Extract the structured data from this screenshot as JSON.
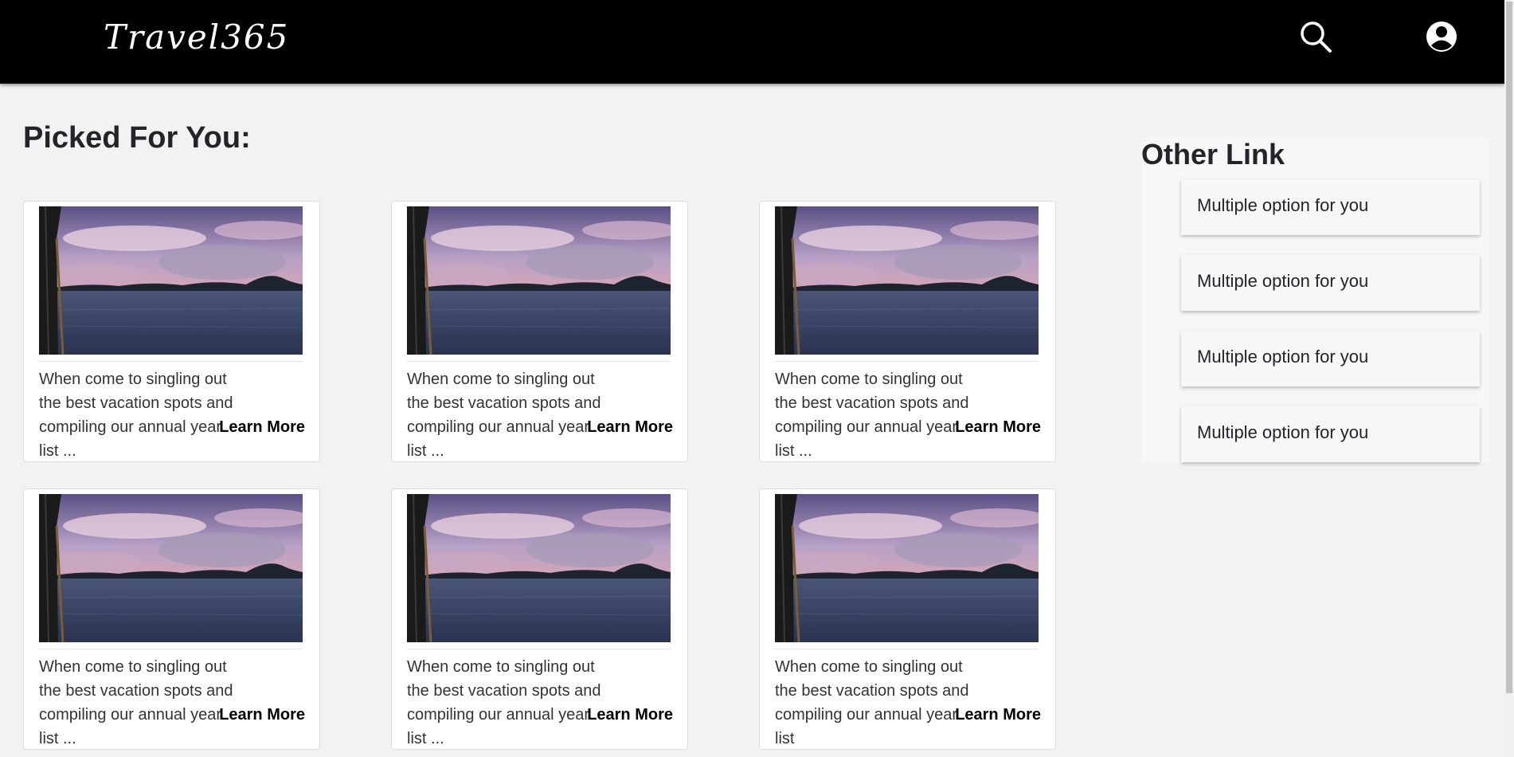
{
  "header": {
    "logo": "Travel365",
    "search_icon": "search-icon",
    "user_icon": "account-circle-icon"
  },
  "main": {
    "title": "Picked For You:",
    "cards": [
      {
        "desc": "When come to singling out the best vacation spots and compiling our annual year list ...",
        "link": "Learn More"
      },
      {
        "desc": "When come to singling out the best vacation spots and compiling our annual year list ...",
        "link": "Learn More"
      },
      {
        "desc": "When come to singling out the best vacation spots and compiling our annual year list ...",
        "link": "Learn More"
      },
      {
        "desc": "When come to singling out the best vacation spots and compiling our annual year list ...",
        "link": "Learn More"
      },
      {
        "desc": "When come to singling out the best vacation spots and compiling our annual year list ...",
        "link": "Learn More"
      },
      {
        "desc": "When come to singling out the best vacation spots and compiling our annual year list",
        "link": "Learn More"
      }
    ]
  },
  "sidebar": {
    "title": "Other Link",
    "items": [
      {
        "label": "Multiple option for you"
      },
      {
        "label": "Multiple option for you"
      },
      {
        "label": "Multiple option for you"
      },
      {
        "label": "Multiple option for you"
      }
    ]
  },
  "colors": {
    "header_bg": "#000000",
    "page_bg": "#f2f2f2",
    "card_bg": "#ffffff"
  }
}
